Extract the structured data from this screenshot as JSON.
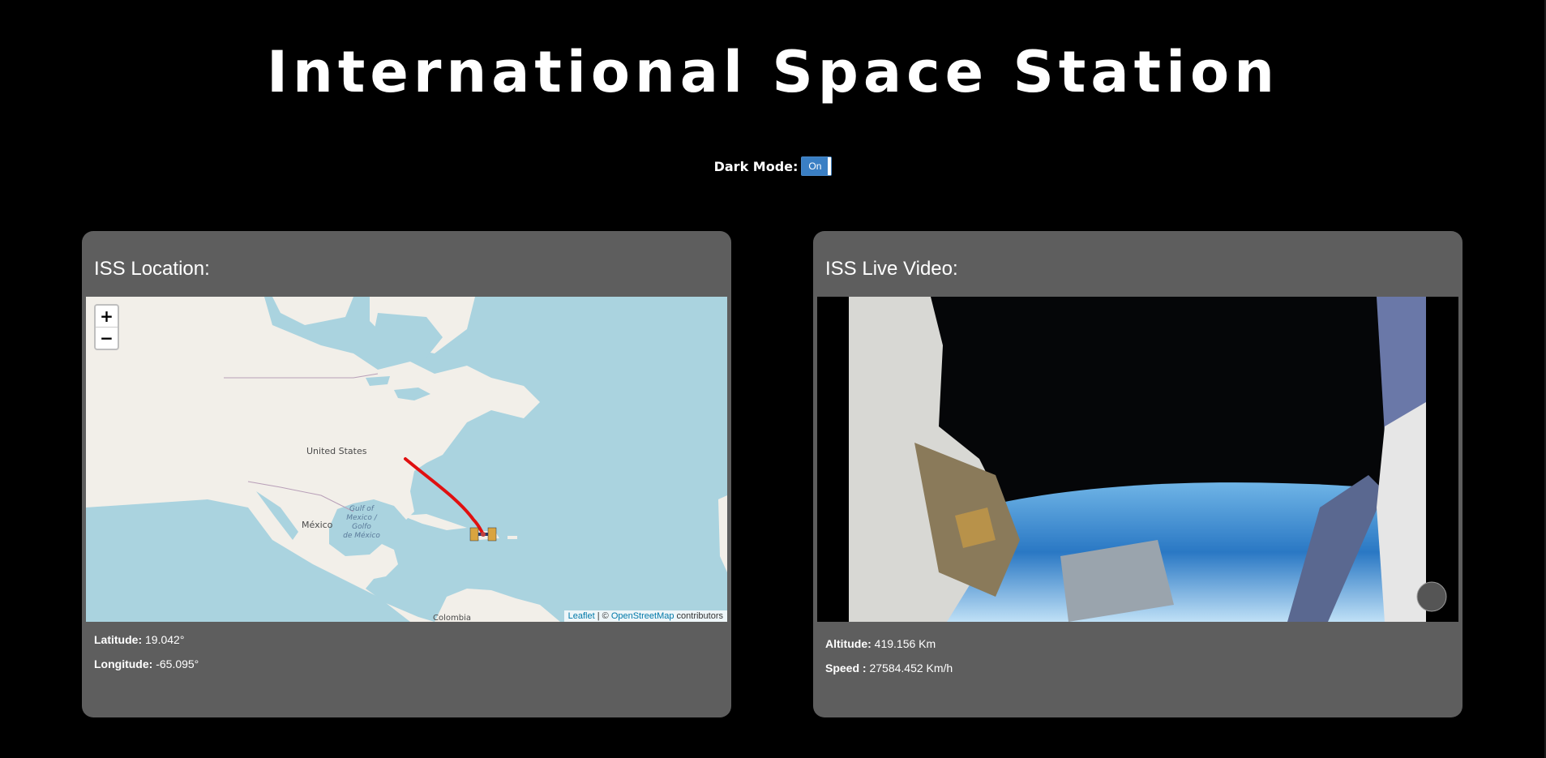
{
  "page": {
    "title": "International Space Station"
  },
  "dark_mode": {
    "label": "Dark Mode:",
    "state": "On"
  },
  "location": {
    "heading": "ISS Location:",
    "map": {
      "zoom_in": "+",
      "zoom_out": "−",
      "labels": {
        "united_states": "United States",
        "mexico": "México",
        "gulf_line1": "Gulf of",
        "gulf_line2": "Mexico /",
        "gulf_line3": "Golfo",
        "gulf_line4": "de México",
        "colombia": "Colombia"
      },
      "attribution": {
        "leaflet": "Leaflet",
        "separator": " | © ",
        "osm": "OpenStreetMap",
        "contributors": " contributors"
      },
      "track_color": "#e01010"
    },
    "latitude_label": "Latitude:",
    "latitude_value": "19.042°",
    "longitude_label": "Longitude:",
    "longitude_value": "-65.095°"
  },
  "video": {
    "heading": "ISS Live Video:",
    "altitude_label": "Altitude:",
    "altitude_value": "419.156 Km",
    "speed_label": "Speed :",
    "speed_value": "27584.452 Km/h"
  },
  "colors": {
    "background": "#000000",
    "card": "#5e5e5e",
    "toggle": "#3a7fc4",
    "water": "#aad3df",
    "land": "#f2efe9"
  }
}
